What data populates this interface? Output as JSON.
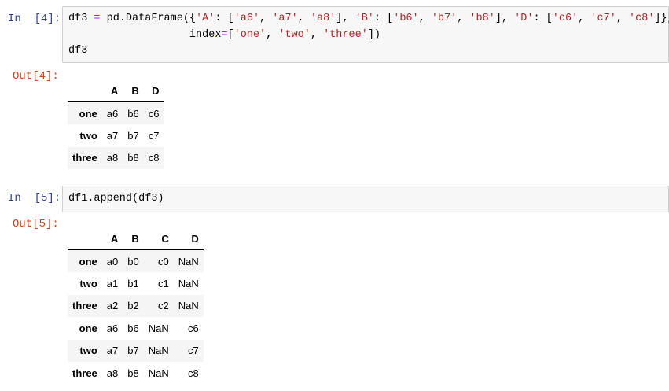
{
  "cells": [
    {
      "in_prompt": "In  [4]:",
      "out_prompt": "Out[4]:",
      "code_lines": [
        [
          {
            "t": "df3 ",
            "c": ""
          },
          {
            "t": "=",
            "c": "o"
          },
          {
            "t": " pd.DataFrame({",
            "c": ""
          },
          {
            "t": "'A'",
            "c": "s"
          },
          {
            "t": ": [",
            "c": ""
          },
          {
            "t": "'a6'",
            "c": "s"
          },
          {
            "t": ", ",
            "c": ""
          },
          {
            "t": "'a7'",
            "c": "s"
          },
          {
            "t": ", ",
            "c": ""
          },
          {
            "t": "'a8'",
            "c": "s"
          },
          {
            "t": "], ",
            "c": ""
          },
          {
            "t": "'B'",
            "c": "s"
          },
          {
            "t": ": [",
            "c": ""
          },
          {
            "t": "'b6'",
            "c": "s"
          },
          {
            "t": ", ",
            "c": ""
          },
          {
            "t": "'b7'",
            "c": "s"
          },
          {
            "t": ", ",
            "c": ""
          },
          {
            "t": "'b8'",
            "c": "s"
          },
          {
            "t": "], ",
            "c": ""
          },
          {
            "t": "'D'",
            "c": "s"
          },
          {
            "t": ": [",
            "c": ""
          },
          {
            "t": "'c6'",
            "c": "s"
          },
          {
            "t": ", ",
            "c": ""
          },
          {
            "t": "'c7'",
            "c": "s"
          },
          {
            "t": ", ",
            "c": ""
          },
          {
            "t": "'c8'",
            "c": "s"
          },
          {
            "t": "]},",
            "c": ""
          }
        ],
        [
          {
            "t": "                   index",
            "c": ""
          },
          {
            "t": "=",
            "c": "o"
          },
          {
            "t": "[",
            "c": ""
          },
          {
            "t": "'one'",
            "c": "s"
          },
          {
            "t": ", ",
            "c": ""
          },
          {
            "t": "'two'",
            "c": "s"
          },
          {
            "t": ", ",
            "c": ""
          },
          {
            "t": "'three'",
            "c": "s"
          },
          {
            "t": "])",
            "c": ""
          }
        ],
        [
          {
            "t": "df3",
            "c": ""
          }
        ]
      ],
      "table": {
        "columns": [
          "A",
          "B",
          "D"
        ],
        "rows": [
          {
            "index": "one",
            "values": [
              "a6",
              "b6",
              "c6"
            ]
          },
          {
            "index": "two",
            "values": [
              "a7",
              "b7",
              "c7"
            ]
          },
          {
            "index": "three",
            "values": [
              "a8",
              "b8",
              "c8"
            ]
          }
        ]
      }
    },
    {
      "in_prompt": "In  [5]:",
      "out_prompt": "Out[5]:",
      "code_lines": [
        [
          {
            "t": "df1.append(df3)",
            "c": ""
          }
        ]
      ],
      "table": {
        "columns": [
          "A",
          "B",
          "C",
          "D"
        ],
        "rows": [
          {
            "index": "one",
            "values": [
              "a0",
              "b0",
              "c0",
              "NaN"
            ]
          },
          {
            "index": "two",
            "values": [
              "a1",
              "b1",
              "c1",
              "NaN"
            ]
          },
          {
            "index": "three",
            "values": [
              "a2",
              "b2",
              "c2",
              "NaN"
            ]
          },
          {
            "index": "one",
            "values": [
              "a6",
              "b6",
              "NaN",
              "c6"
            ]
          },
          {
            "index": "two",
            "values": [
              "a7",
              "b7",
              "NaN",
              "c7"
            ]
          },
          {
            "index": "three",
            "values": [
              "a8",
              "b8",
              "NaN",
              "c8"
            ]
          }
        ]
      }
    }
  ]
}
